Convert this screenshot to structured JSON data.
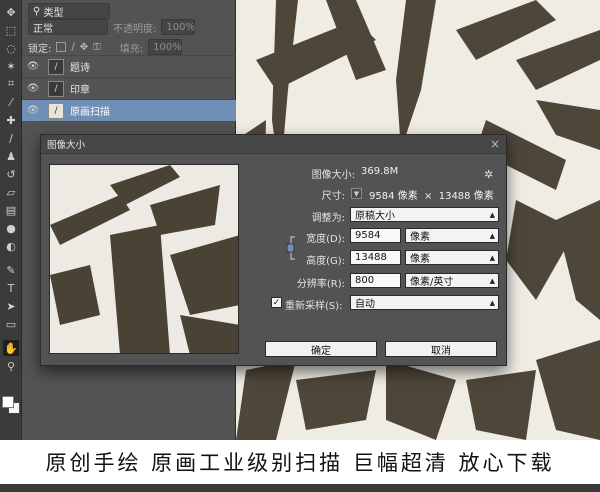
{
  "layers_panel": {
    "filter_kind": "类型",
    "blend_mode": "正常",
    "opacity_label": "不透明度:",
    "opacity_value": "100%",
    "lock_label": "锁定:",
    "fill_label": "填充:",
    "fill_value": "100%",
    "layers": [
      {
        "name": "题诗",
        "visible": true,
        "selected": false
      },
      {
        "name": "印章",
        "visible": true,
        "selected": false
      },
      {
        "name": "原画扫描",
        "visible": true,
        "selected": true
      }
    ]
  },
  "dialog": {
    "title": "图像大小",
    "image_size_label": "图像大小:",
    "image_size_value": "369.8M",
    "dimensions_label": "尺寸:",
    "dimensions_value": "9584 像素  ×  13488 像素",
    "fit_to_label": "调整为:",
    "fit_to_value": "原稿大小",
    "width_label": "宽度(D):",
    "width_value": "9584",
    "width_unit": "像素",
    "height_label": "高度(G):",
    "height_value": "13488",
    "height_unit": "像素",
    "resolution_label": "分辨率(R):",
    "resolution_value": "800",
    "resolution_unit": "像素/英寸",
    "resample_label": "重新采样(S):",
    "resample_checked": true,
    "resample_value": "自动",
    "ok_label": "确定",
    "cancel_label": "取消"
  },
  "caption": "原创手绘 原画工业级别扫描 巨幅超清 放心下载",
  "icons": [
    "move-icon",
    "marquee-icon",
    "lasso-icon",
    "magic-wand-icon",
    "crop-icon",
    "eyedropper-icon",
    "healing-icon",
    "brush-icon",
    "stamp-icon",
    "history-brush-icon",
    "eraser-icon",
    "gradient-icon",
    "blur-icon",
    "dodge-icon",
    "pen-icon",
    "type-icon",
    "path-select-icon",
    "shape-icon",
    "hand-icon",
    "zoom-icon",
    "eye-icon",
    "gear-icon",
    "chain-link-icon"
  ],
  "colors": {
    "panel_bg": "#535353",
    "selected_layer": "#6f8fb7",
    "ink": "#3d3527",
    "paper": "#efece4"
  }
}
